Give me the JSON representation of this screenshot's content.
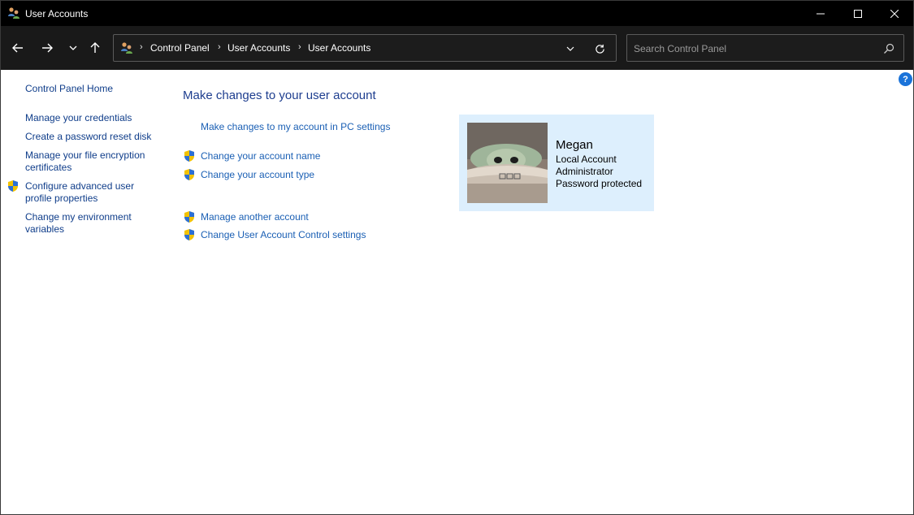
{
  "window": {
    "title": "User Accounts",
    "icon": "users-icon",
    "controls": [
      "minimize-icon",
      "maximize-icon",
      "close-icon"
    ]
  },
  "navigation": {
    "breadcrumb": [
      "Control Panel",
      "User Accounts",
      "User Accounts"
    ],
    "search": {
      "placeholder": "Search Control Panel",
      "value": ""
    }
  },
  "help": {
    "label": "?"
  },
  "sidebar": {
    "home": "Control Panel Home",
    "links": [
      {
        "lines": [
          "Manage your credentials"
        ],
        "shield": false
      },
      {
        "lines": [
          "Create a password reset disk"
        ],
        "shield": false
      },
      {
        "lines": [
          "Manage your file encryption",
          "certificates"
        ],
        "shield": false
      },
      {
        "lines": [
          "Configure advanced user",
          "profile properties"
        ],
        "shield": true
      },
      {
        "lines": [
          "Change my environment",
          "variables"
        ],
        "shield": false
      }
    ]
  },
  "main": {
    "title": "Make changes to your user account",
    "pc_settings_link": "Make changes to my account in PC settings",
    "tasks": [
      {
        "label": "Change your account name",
        "shield": true
      },
      {
        "label": "Change your account type",
        "shield": true
      }
    ],
    "other_tasks": [
      {
        "label": "Manage another account",
        "shield": true
      },
      {
        "label": "Change User Account Control settings",
        "shield": true
      }
    ]
  },
  "account": {
    "name": "Megan",
    "type": "Local Account",
    "role": "Administrator",
    "status": "Password protected"
  },
  "colors": {
    "titlebar": "#000000",
    "navbar": "#191919",
    "link": "#1a5fb4",
    "title": "#1e3e8f",
    "card": "#ddeffd",
    "help": "#1a73d9"
  }
}
